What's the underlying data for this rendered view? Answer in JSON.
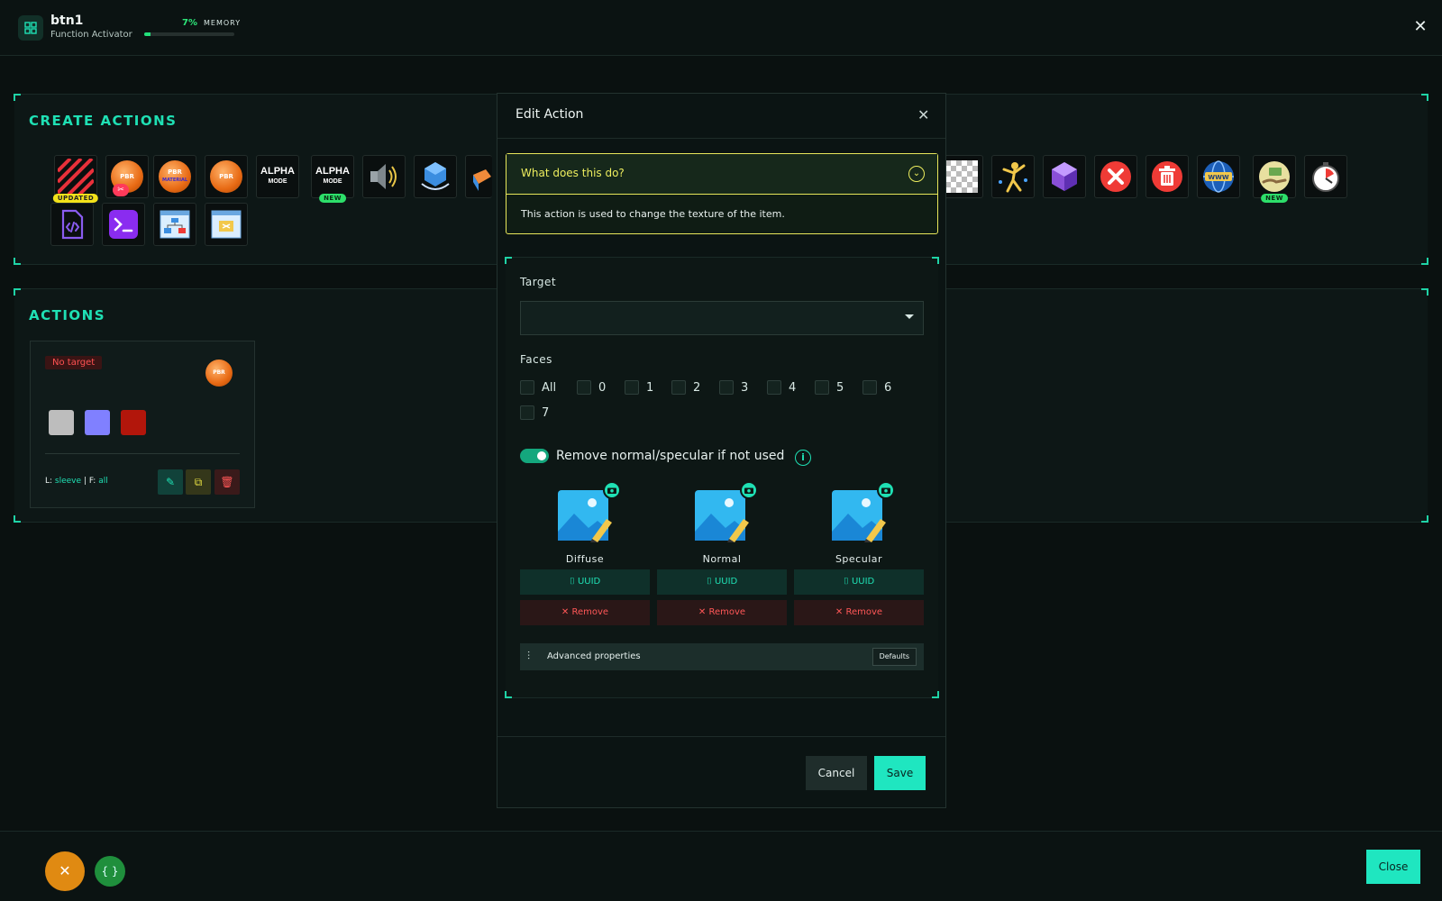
{
  "header": {
    "title": "btn1",
    "subtitle": "Function Activator",
    "memory_percent": "7%",
    "memory_label": "MEMORY",
    "memory_fraction": 0.07
  },
  "create_actions": {
    "title": "CREATE ACTIONS",
    "badges": {
      "updated": "UPDATED",
      "new": "NEW"
    },
    "tiles": {
      "pbr_material": "PBR",
      "material": "MATERIAL",
      "alpha": "ALPHA",
      "mode": "MODE"
    }
  },
  "actions": {
    "title": "ACTIONS",
    "card": {
      "status": "No target",
      "orb_label": "PBR",
      "link_label": "L:",
      "link_value": "sleeve",
      "face_label": "| F:",
      "face_value": "all"
    }
  },
  "modal": {
    "title": "Edit Action",
    "help_question": "What does this do?",
    "help_answer": "This action is used to change the texture of the item.",
    "target_label": "Target",
    "target_value": "",
    "faces_label": "Faces",
    "faces": [
      "All",
      "0",
      "1",
      "2",
      "3",
      "4",
      "5",
      "6",
      "7"
    ],
    "toggle_label": "Remove normal/specular if not used",
    "toggle_on": true,
    "textures": [
      {
        "name": "Diffuse",
        "uuid_label": "UUID",
        "remove_label": "Remove"
      },
      {
        "name": "Normal",
        "uuid_label": "UUID",
        "remove_label": "Remove"
      },
      {
        "name": "Specular",
        "uuid_label": "UUID",
        "remove_label": "Remove"
      }
    ],
    "advanced_label": "Advanced properties",
    "defaults_label": "Defaults",
    "cancel_label": "Cancel",
    "save_label": "Save"
  },
  "footer": {
    "close_label": "Close"
  },
  "colors": {
    "accent": "#1fe0b4",
    "danger": "#ff5757",
    "warning": "#eded5e"
  }
}
